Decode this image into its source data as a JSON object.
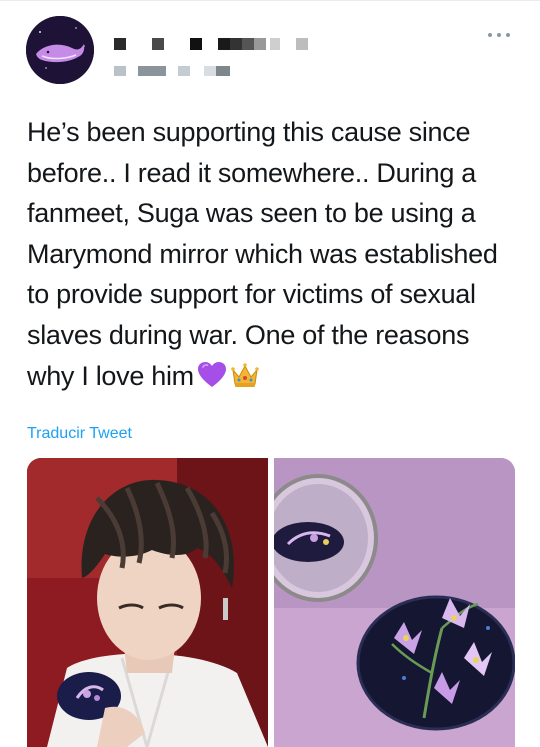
{
  "tweet": {
    "text": "He’s been supporting this cause since before.. I read it somewhere.. During a fanmeet, Suga was seen to be using a Marymond mirror which was established to provide support for victims of sexual slaves during war. One of the reasons why I love him",
    "emojis": [
      "purple-heart-icon",
      "crown-icon"
    ]
  },
  "translate_label": "Traducir Tweet",
  "user": {
    "avatar_icon": "whale-icon",
    "name_redacted": true,
    "handle_redacted": true
  },
  "colors": {
    "link": "#1da1f2",
    "text": "#14171a",
    "muted": "#8899a6"
  },
  "media": [
    {
      "icon": "person-with-mirror-photo"
    },
    {
      "icon": "marymond-mirror-photo"
    }
  ]
}
